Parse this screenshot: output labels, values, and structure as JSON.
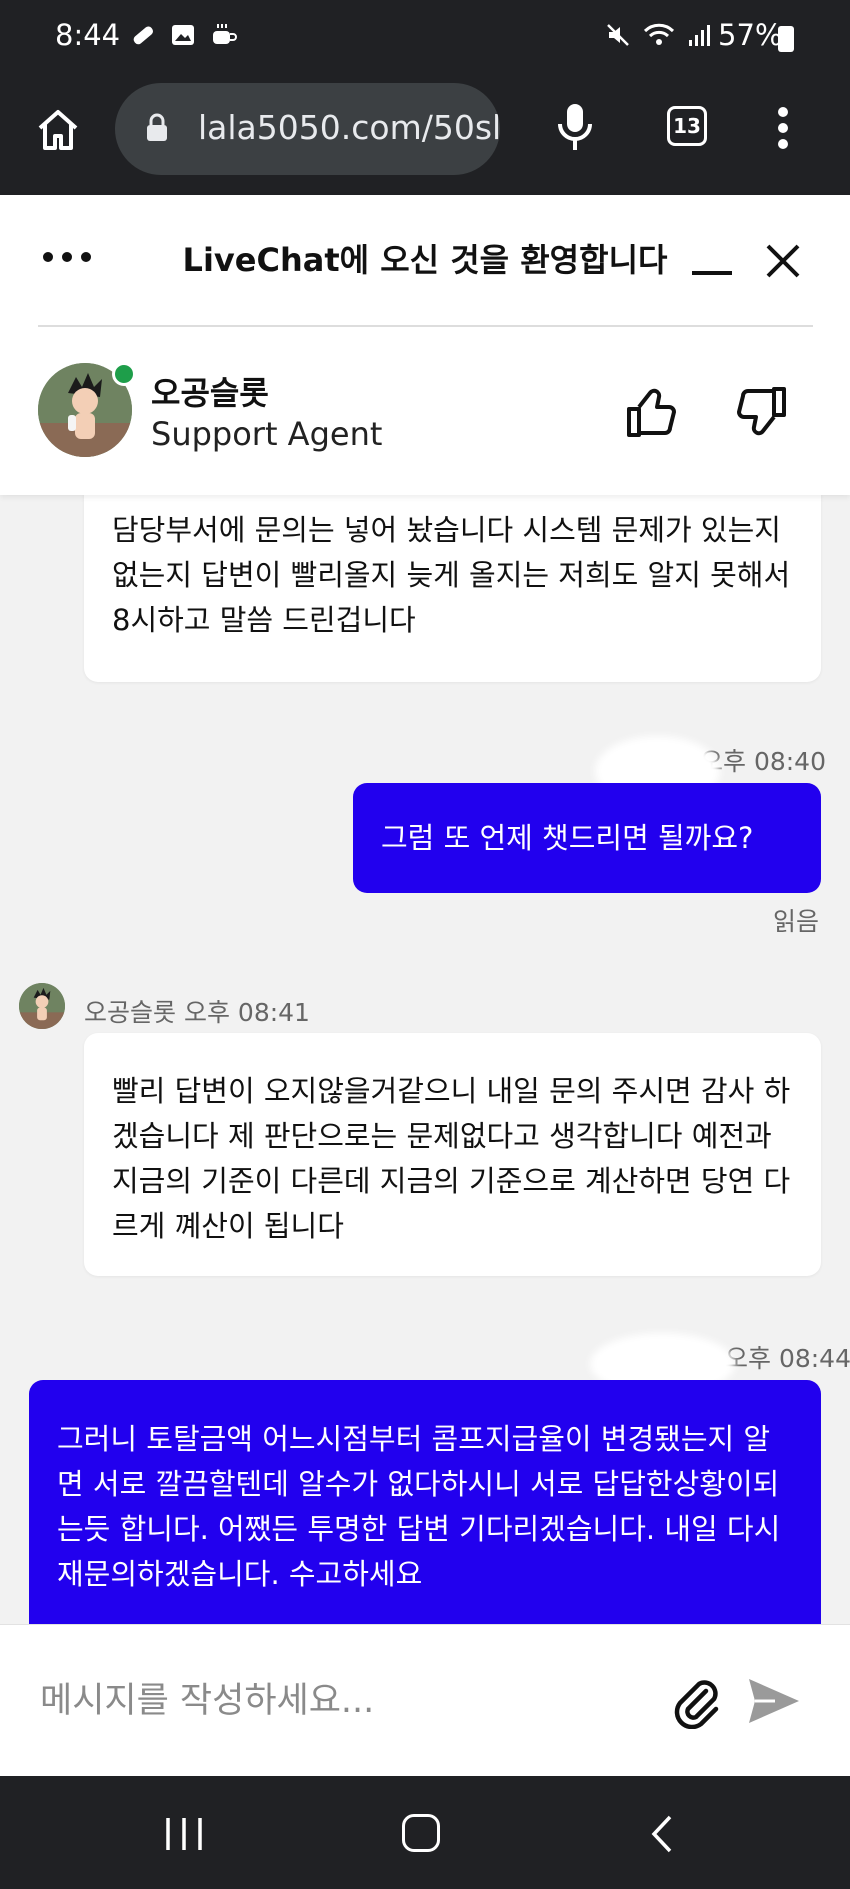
{
  "status_bar": {
    "time": "8:44",
    "battery": "57%",
    "icons": [
      "band-aid-icon",
      "image-icon",
      "coffee-icon",
      "mute-icon",
      "wifi-icon",
      "signal-icon",
      "battery-icon"
    ]
  },
  "browser": {
    "url": "lala5050.com/50sl",
    "tab_count": "13"
  },
  "chat_header": {
    "title": "LiveChat에 오신 것을 환영합니다",
    "agent_name": "오공슬롯",
    "agent_role": "Support Agent"
  },
  "messages": {
    "m1_text": "담당부서에 문의는 넣어 놨습니다 시스템 문제가 있는지 없는지 답변이 빨리올지 늦게 올지는 저희도 알지 못해서 8시하고 말씀 드린겁니다",
    "m2_time": "오후 08:40",
    "m2_text": "그럼 또 언제 챗드리면 될까요?",
    "m2_status": "읽음",
    "m3_sender": "오공슬롯",
    "m3_time": "오후 08:41",
    "m3_text": "빨리 답변이 오지않을거같으니 내일 문의 주시면 감사 하겠습니다 제 판단으로는 문제없다고 생각합니다 예전과 지금의 기준이 다른데 지금의 기준으로 계산하면 당연 다르게 꼐산이 됩니다",
    "m4_time": "오후 08:44",
    "m4_text": "그러니 토탈금액 어느시점부터 콤프지급율이 변경됐는지 알면 서로 깔끔할텐데 알수가 없다하시니 서로 답답한상황이되는듯 합니다. 어쨌든 투명한 답변 기다리겠습니다. 내일 다시 재문의하겠습니다. 수고하세요"
  },
  "composer": {
    "placeholder": "메시지를 작성하세요..."
  },
  "colors": {
    "user_bubble": "#2200ee",
    "online": "#1e9e4a",
    "system_bar": "#202124"
  }
}
